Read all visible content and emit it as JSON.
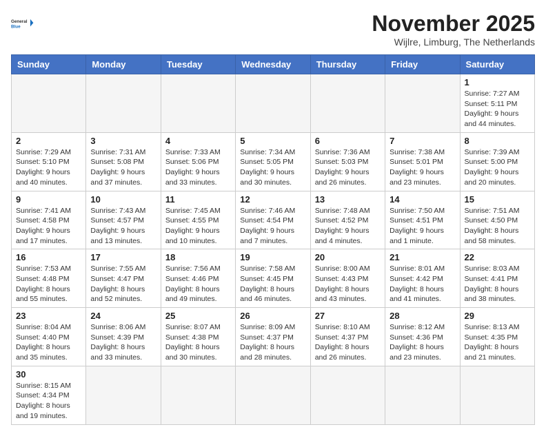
{
  "logo": {
    "general": "General",
    "blue": "Blue"
  },
  "header": {
    "month": "November 2025",
    "location": "Wijlre, Limburg, The Netherlands"
  },
  "weekdays": [
    "Sunday",
    "Monday",
    "Tuesday",
    "Wednesday",
    "Thursday",
    "Friday",
    "Saturday"
  ],
  "days": {
    "d1": {
      "num": "1",
      "info": "Sunrise: 7:27 AM\nSunset: 5:11 PM\nDaylight: 9 hours\nand 44 minutes."
    },
    "d2": {
      "num": "2",
      "info": "Sunrise: 7:29 AM\nSunset: 5:10 PM\nDaylight: 9 hours\nand 40 minutes."
    },
    "d3": {
      "num": "3",
      "info": "Sunrise: 7:31 AM\nSunset: 5:08 PM\nDaylight: 9 hours\nand 37 minutes."
    },
    "d4": {
      "num": "4",
      "info": "Sunrise: 7:33 AM\nSunset: 5:06 PM\nDaylight: 9 hours\nand 33 minutes."
    },
    "d5": {
      "num": "5",
      "info": "Sunrise: 7:34 AM\nSunset: 5:05 PM\nDaylight: 9 hours\nand 30 minutes."
    },
    "d6": {
      "num": "6",
      "info": "Sunrise: 7:36 AM\nSunset: 5:03 PM\nDaylight: 9 hours\nand 26 minutes."
    },
    "d7": {
      "num": "7",
      "info": "Sunrise: 7:38 AM\nSunset: 5:01 PM\nDaylight: 9 hours\nand 23 minutes."
    },
    "d8": {
      "num": "8",
      "info": "Sunrise: 7:39 AM\nSunset: 5:00 PM\nDaylight: 9 hours\nand 20 minutes."
    },
    "d9": {
      "num": "9",
      "info": "Sunrise: 7:41 AM\nSunset: 4:58 PM\nDaylight: 9 hours\nand 17 minutes."
    },
    "d10": {
      "num": "10",
      "info": "Sunrise: 7:43 AM\nSunset: 4:57 PM\nDaylight: 9 hours\nand 13 minutes."
    },
    "d11": {
      "num": "11",
      "info": "Sunrise: 7:45 AM\nSunset: 4:55 PM\nDaylight: 9 hours\nand 10 minutes."
    },
    "d12": {
      "num": "12",
      "info": "Sunrise: 7:46 AM\nSunset: 4:54 PM\nDaylight: 9 hours\nand 7 minutes."
    },
    "d13": {
      "num": "13",
      "info": "Sunrise: 7:48 AM\nSunset: 4:52 PM\nDaylight: 9 hours\nand 4 minutes."
    },
    "d14": {
      "num": "14",
      "info": "Sunrise: 7:50 AM\nSunset: 4:51 PM\nDaylight: 9 hours\nand 1 minute."
    },
    "d15": {
      "num": "15",
      "info": "Sunrise: 7:51 AM\nSunset: 4:50 PM\nDaylight: 8 hours\nand 58 minutes."
    },
    "d16": {
      "num": "16",
      "info": "Sunrise: 7:53 AM\nSunset: 4:48 PM\nDaylight: 8 hours\nand 55 minutes."
    },
    "d17": {
      "num": "17",
      "info": "Sunrise: 7:55 AM\nSunset: 4:47 PM\nDaylight: 8 hours\nand 52 minutes."
    },
    "d18": {
      "num": "18",
      "info": "Sunrise: 7:56 AM\nSunset: 4:46 PM\nDaylight: 8 hours\nand 49 minutes."
    },
    "d19": {
      "num": "19",
      "info": "Sunrise: 7:58 AM\nSunset: 4:45 PM\nDaylight: 8 hours\nand 46 minutes."
    },
    "d20": {
      "num": "20",
      "info": "Sunrise: 8:00 AM\nSunset: 4:43 PM\nDaylight: 8 hours\nand 43 minutes."
    },
    "d21": {
      "num": "21",
      "info": "Sunrise: 8:01 AM\nSunset: 4:42 PM\nDaylight: 8 hours\nand 41 minutes."
    },
    "d22": {
      "num": "22",
      "info": "Sunrise: 8:03 AM\nSunset: 4:41 PM\nDaylight: 8 hours\nand 38 minutes."
    },
    "d23": {
      "num": "23",
      "info": "Sunrise: 8:04 AM\nSunset: 4:40 PM\nDaylight: 8 hours\nand 35 minutes."
    },
    "d24": {
      "num": "24",
      "info": "Sunrise: 8:06 AM\nSunset: 4:39 PM\nDaylight: 8 hours\nand 33 minutes."
    },
    "d25": {
      "num": "25",
      "info": "Sunrise: 8:07 AM\nSunset: 4:38 PM\nDaylight: 8 hours\nand 30 minutes."
    },
    "d26": {
      "num": "26",
      "info": "Sunrise: 8:09 AM\nSunset: 4:37 PM\nDaylight: 8 hours\nand 28 minutes."
    },
    "d27": {
      "num": "27",
      "info": "Sunrise: 8:10 AM\nSunset: 4:37 PM\nDaylight: 8 hours\nand 26 minutes."
    },
    "d28": {
      "num": "28",
      "info": "Sunrise: 8:12 AM\nSunset: 4:36 PM\nDaylight: 8 hours\nand 23 minutes."
    },
    "d29": {
      "num": "29",
      "info": "Sunrise: 8:13 AM\nSunset: 4:35 PM\nDaylight: 8 hours\nand 21 minutes."
    },
    "d30": {
      "num": "30",
      "info": "Sunrise: 8:15 AM\nSunset: 4:34 PM\nDaylight: 8 hours\nand 19 minutes."
    }
  }
}
